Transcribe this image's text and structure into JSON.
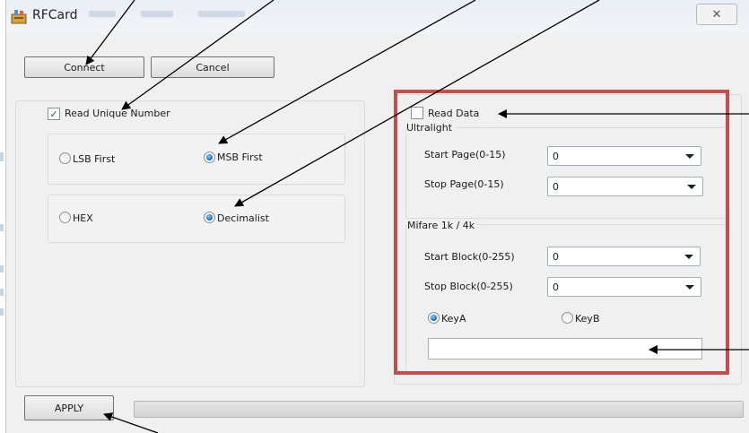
{
  "window": {
    "title": "RFCard",
    "close_symbol": "✕",
    "icon": "rfcard-app-icon"
  },
  "buttons": {
    "connect": "Connect",
    "cancel": "Cancel",
    "apply": "APPLY"
  },
  "unique_number": {
    "checkbox_label": "Read Unique Number",
    "checked": true,
    "lsb_first": "LSB First",
    "msb_first": "MSB First",
    "byte_order_selected": "MSB First",
    "hex": "HEX",
    "decimalist": "Decimalist",
    "format_selected": "Decimalist"
  },
  "read_data": {
    "checkbox_label": "Read Data",
    "checked": false,
    "ultralight": {
      "title": "Ultralight",
      "start_page_label": "Start Page(0-15)",
      "start_page_value": "0",
      "stop_page_label": "Stop Page(0-15)",
      "stop_page_value": "0"
    },
    "mifare": {
      "title": "Mifare 1k / 4k",
      "start_block_label": "Start Block(0-255)",
      "start_block_value": "0",
      "stop_block_label": "Stop Block(0-255)",
      "stop_block_value": "0",
      "key_a": "KeyA",
      "key_b": "KeyB",
      "key_selected": "KeyA",
      "key_value": ""
    }
  },
  "progress": {
    "value": 0
  },
  "colors": {
    "highlight": "#c0504d",
    "radio_on": "#1566b7",
    "arrow": "#000000"
  }
}
